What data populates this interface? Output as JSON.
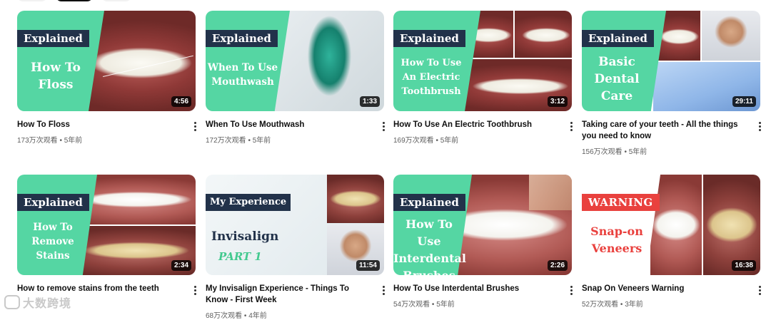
{
  "videos": [
    {
      "title": "How To Floss",
      "banner": "Explained",
      "thumb_text": "How To\nFloss",
      "duration": "4:56",
      "views": "173万次观看",
      "age": "5年前"
    },
    {
      "title": "When To Use Mouthwash",
      "banner": "Explained",
      "thumb_text": "When To Use\nMouthwash",
      "duration": "1:33",
      "views": "172万次观看",
      "age": "5年前"
    },
    {
      "title": "How To Use An Electric Toothbrush",
      "banner": "Explained",
      "thumb_text": "How To Use\nAn Electric\nToothbrush",
      "duration": "3:12",
      "views": "169万次观看",
      "age": "5年前"
    },
    {
      "title": "Taking care of your teeth - All the things you need to know",
      "banner": "Explained",
      "thumb_text": "Basic\nDental\nCare",
      "duration": "29:11",
      "views": "156万次观看",
      "age": "5年前"
    },
    {
      "title": "How to remove stains from the teeth",
      "banner": "Explained",
      "thumb_text": "How To\nRemove\nStains",
      "duration": "2:34",
      "views": "",
      "age": ""
    },
    {
      "title": "My Invisalign Experience - Things To Know - First Week",
      "banner": "My Experience",
      "thumb_text": "Invisalign",
      "thumb_sub": "PART 1",
      "duration": "11:54",
      "views": "68万次观看",
      "age": "4年前"
    },
    {
      "title": "How To Use Interdental Brushes",
      "banner": "Explained",
      "thumb_text": "How To Use\nInterdental\nBrushes",
      "duration": "2:26",
      "views": "54万次观看",
      "age": "5年前"
    },
    {
      "title": "Snap On Veneers Warning",
      "banner": "WARNING",
      "thumb_text": "Snap-on\nVeneers",
      "duration": "16:38",
      "views": "52万次观看",
      "age": "3年前"
    }
  ],
  "meta_separator": " • ",
  "watermark": "大数跨境",
  "colors": {
    "mint": "#55d6a3",
    "navy": "#22324a",
    "red": "#e9413e"
  }
}
